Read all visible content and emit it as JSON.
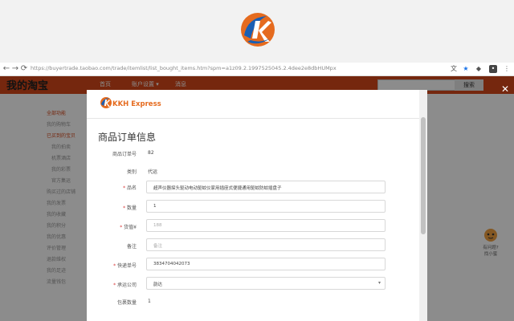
{
  "browser": {
    "url": "https://buyertrade.taobao.com/trade/itemlist/list_bought_items.htm?spm=a1z09.2.1997525045.2.4dee2e8dbHUMpx"
  },
  "site": {
    "title": "我的淘宝",
    "nav": [
      "首页",
      "账户设置 ▾",
      "消息"
    ],
    "search_button": "搜索",
    "left_menu": [
      "全部功能",
      "我的购物车",
      "已买到的宝贝",
      "我的拍卖",
      "机票酒店",
      "我的彩票",
      "官方集运",
      "购买过的店铺",
      "我的发票",
      "我的收藏",
      "我的积分",
      "我的优惠",
      "评价管理",
      "退款维权",
      "我的足迹",
      "流量钱包"
    ]
  },
  "modal": {
    "brand": "KKH Express",
    "title": "商品订单信息",
    "rows": [
      {
        "label": "商品订单号",
        "value": "82",
        "type": "text"
      },
      {
        "label": "类别",
        "value": "代运",
        "type": "text"
      },
      {
        "label": "品名",
        "required": true,
        "value": "超声仪器探头驱动电动驱蚊仪家用插座式便捷通用驱蚊防蚊插盘子",
        "type": "input"
      },
      {
        "label": "数量",
        "required": true,
        "value": "1",
        "type": "input"
      },
      {
        "label": "货值¥",
        "required": true,
        "value": "188",
        "type": "input",
        "placeholder_style": true
      },
      {
        "label": "备注",
        "value": "备注",
        "type": "input",
        "placeholder_style": true
      },
      {
        "label": "快递单号",
        "required": true,
        "value": "3834704042073",
        "type": "input"
      },
      {
        "label": "承运公司",
        "required": true,
        "value": "韵达",
        "type": "select"
      },
      {
        "label": "包裹数量",
        "value": "1",
        "type": "text"
      }
    ]
  },
  "customer_service": {
    "label": "有问题? 找小蜜"
  },
  "colors": {
    "site_orange": "#d5481a",
    "kkh_orange": "#e56b1f",
    "kkh_blue": "#1a5fb4",
    "required_red": "#d93b3b"
  }
}
